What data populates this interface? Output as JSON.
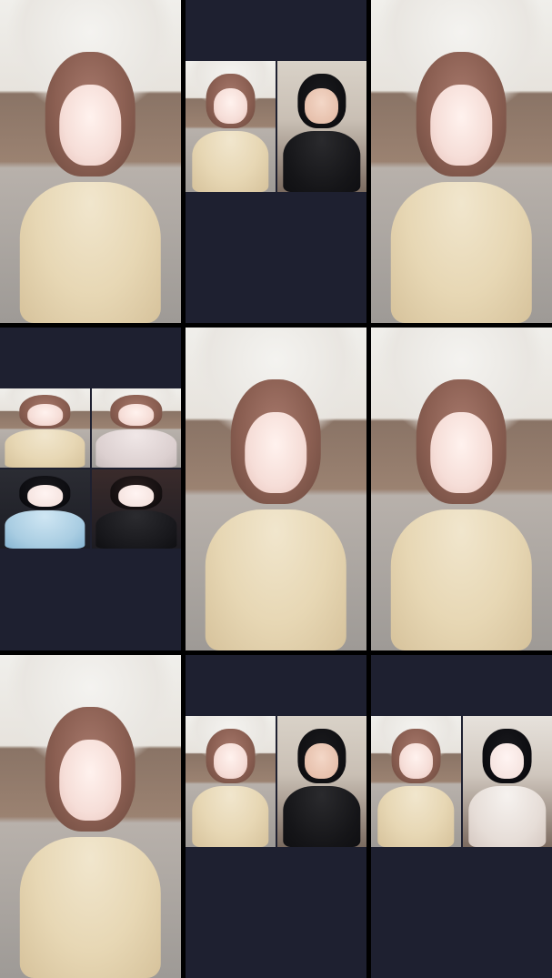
{
  "app": {
    "title": ""
  },
  "grid": {
    "rows": 3,
    "cols": 3,
    "tiles": [
      {
        "id": "r1c1",
        "kind": "single"
      },
      {
        "id": "r1c2",
        "kind": "split-2"
      },
      {
        "id": "r1c3",
        "kind": "single"
      },
      {
        "id": "r2c1",
        "kind": "quad"
      },
      {
        "id": "r2c2",
        "kind": "single"
      },
      {
        "id": "r2c3",
        "kind": "single"
      },
      {
        "id": "r3c1",
        "kind": "single"
      },
      {
        "id": "r3c2",
        "kind": "split-2"
      },
      {
        "id": "r3c3",
        "kind": "split-2"
      }
    ]
  },
  "colors": {
    "background": "#000000",
    "cell_background": "#1e2030"
  }
}
